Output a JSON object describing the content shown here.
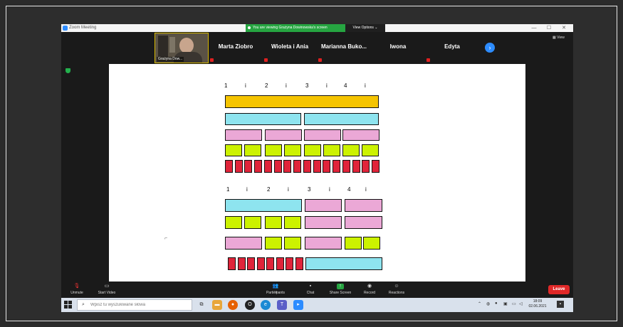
{
  "window": {
    "title": "Zoom Meeting",
    "minimize": "—",
    "maximize": "☐",
    "close": "✕"
  },
  "banner": {
    "text": "You are viewing Grażyna Dowinowska's screen",
    "view_options": "View Options ⌄"
  },
  "self_view": {
    "name": "Grażyna Dow..."
  },
  "participants": [
    "Marta Ziobro",
    "Wioleta i Ania",
    "Marianna Buko...",
    "Iwona",
    "Edyta"
  ],
  "view_button": "View",
  "shared_screen": {
    "top_labels": [
      "1",
      "i",
      "2",
      "i",
      "3",
      "i",
      "4",
      "i"
    ],
    "bottom_labels": [
      "1",
      "i",
      "2",
      "i",
      "3",
      "i",
      "4",
      "i"
    ],
    "colors": {
      "whole": "#f5c400",
      "half": "#8ee4ef",
      "quarter": "#eba8d6",
      "eighth": "#ccf200",
      "sixteenth": "#e0243a"
    }
  },
  "controls": {
    "unmute": "Unmute",
    "start_video": "Start Video",
    "participants": "Participants",
    "participants_count": "14",
    "chat": "Chat",
    "share_screen": "Share Screen",
    "record": "Record",
    "reactions": "Reactions",
    "leave": "Leave"
  },
  "taskbar": {
    "search_placeholder": "Wpisz tu wyszukiwane słowa",
    "time": "18:09",
    "date": "02.06.2021"
  }
}
